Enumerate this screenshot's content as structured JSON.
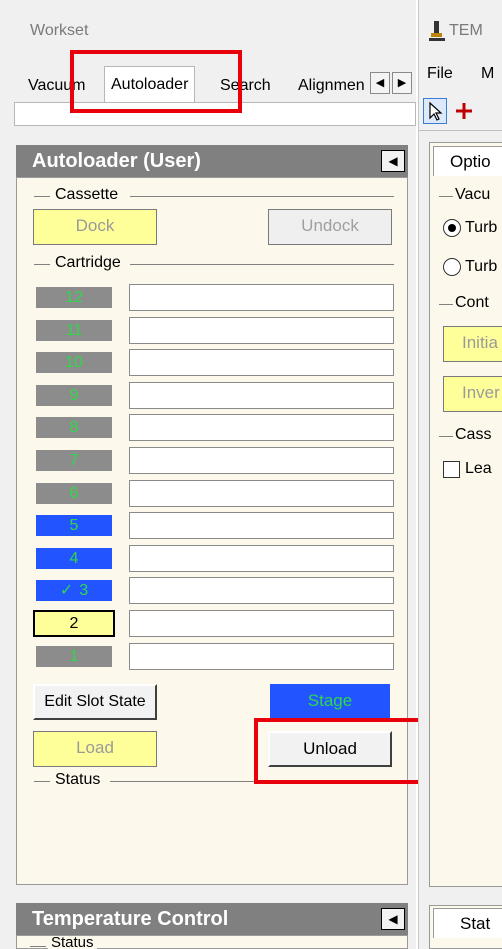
{
  "workset": {
    "title": "Workset",
    "tabs": [
      "Vacuum",
      "Autoloader",
      "Search",
      "Alignmen"
    ],
    "active_tab": "Autoloader",
    "scroll_left": "◀",
    "scroll_right": "▶"
  },
  "autoloader": {
    "title": "Autoloader (User)",
    "collapse_glyph": "◀",
    "cassette": {
      "label": "Cassette",
      "dock": "Dock",
      "undock": "Undock"
    },
    "cartridge": {
      "label": "Cartridge",
      "slots": [
        {
          "number": "12",
          "state": "gray"
        },
        {
          "number": "11",
          "state": "gray"
        },
        {
          "number": "10",
          "state": "gray"
        },
        {
          "number": "9",
          "state": "gray"
        },
        {
          "number": "8",
          "state": "gray"
        },
        {
          "number": "7",
          "state": "gray"
        },
        {
          "number": "6",
          "state": "gray"
        },
        {
          "number": "5",
          "state": "blue"
        },
        {
          "number": "4",
          "state": "blue"
        },
        {
          "number": "3",
          "state": "blue",
          "check": "✓"
        },
        {
          "number": "2",
          "state": "yellow"
        },
        {
          "number": "1",
          "state": "gray"
        }
      ]
    },
    "edit_slot_state": "Edit Slot State",
    "stage": "Stage",
    "load": "Load",
    "unload": "Unload",
    "status_label": "Status"
  },
  "temperature": {
    "title": "Temperature Control",
    "collapse_glyph": "◀",
    "status_label": "Status"
  },
  "right_panel": {
    "app_title": "TEM",
    "menu_file": "File",
    "menu_more": "M",
    "options_tab": "Optio",
    "vacuum_label": "Vacu",
    "radio_1": "Turb",
    "radio_2": "Turb",
    "cont_label": "Cont",
    "initialize_btn": "Initia",
    "invert_btn": "Inver",
    "cass_label": "Cass",
    "leave_checkbox": "Lea",
    "status_tab": "Stat"
  },
  "colors": {
    "panel_header": "#808080",
    "panel_body": "#fdf8ec",
    "highlight_box": "#e8000b",
    "slot_gray": "#8c8c8c",
    "slot_blue": "#2255ff",
    "slot_number_green": "#2fd84a",
    "button_yellow": "#ffff99"
  }
}
